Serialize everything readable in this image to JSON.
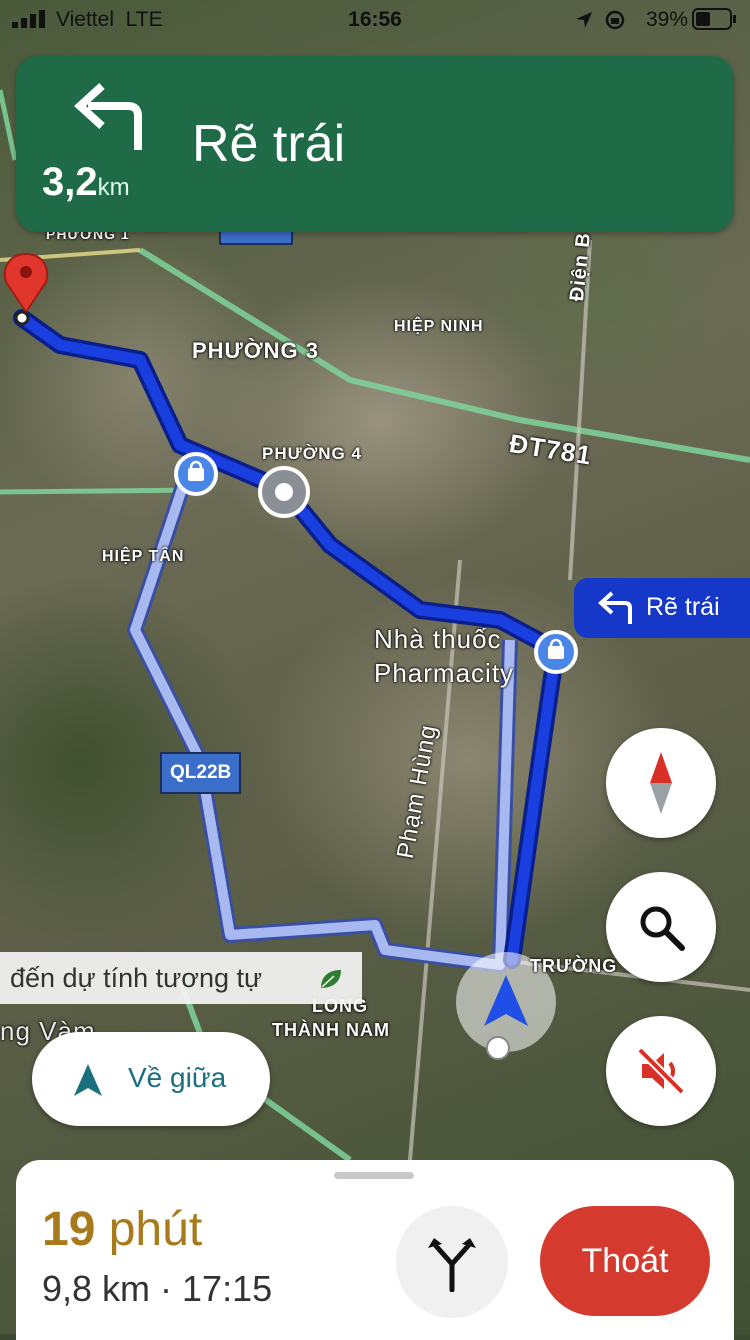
{
  "status_bar": {
    "carrier": "Viettel",
    "network": "LTE",
    "time": "16:56",
    "battery": "39%"
  },
  "banner": {
    "instruction": "Rẽ trái",
    "distance": "3,2",
    "unit": "km",
    "icon": "turn-left-arrow-icon",
    "color": "#1f6b47"
  },
  "map_labels": {
    "phuong1": "PHƯỜNG 1",
    "phuong3": "PHƯỜNG 3",
    "phuong4": "PHƯỜNG 4",
    "hiep_ninh": "HIỆP NINH",
    "hiep_tan": "HIỆP TÂN",
    "dt781": "ĐT781",
    "dien_bien": "Điện B",
    "pharmacy_line1": "Nhà thuốc",
    "pharmacy_line2": "Pharmacity",
    "pham_hung": "Phạm Hùng",
    "long_thanh_nam_1": "LONG",
    "long_thanh_nam_2": "THÀNH NAM",
    "vam": "ng Vàm",
    "truong": "TRƯỜNG",
    "ql22b": "QL22B"
  },
  "callout": {
    "label": "Rẽ trái",
    "icon": "turn-left-arrow-icon"
  },
  "similar_route": {
    "text": "đến dự tính tương tự",
    "icon": "leaf-icon"
  },
  "buttons": {
    "recenter": "Về giữa",
    "exit": "Thoát"
  },
  "fabs": [
    "compass-icon",
    "search-icon",
    "sound-off-icon"
  ],
  "trip": {
    "minutes": "19",
    "minutes_unit": "phút",
    "summary": "9,8 km · 17:15"
  },
  "colors": {
    "route": "#1a3fe0",
    "alt_route": "#a8b8f0",
    "exit": "#d43a2e",
    "eta": "#a87a1c"
  }
}
